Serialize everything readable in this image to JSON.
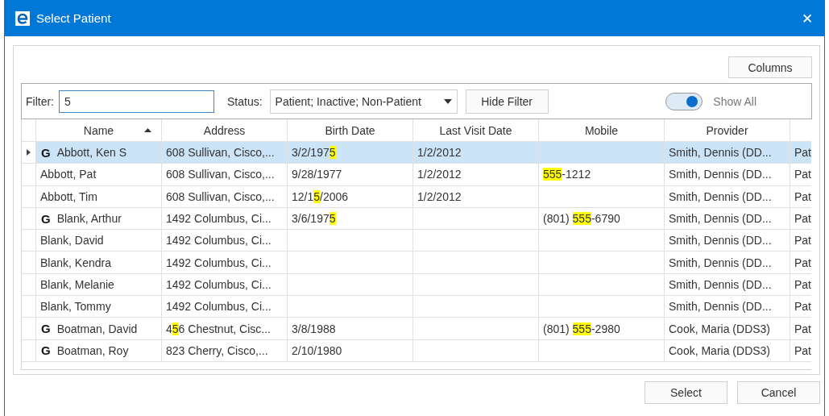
{
  "window": {
    "title": "Select Patient",
    "close": "✕"
  },
  "columns_button": "Columns",
  "filter": {
    "label": "Filter:",
    "value": "5",
    "status_label": "Status:",
    "status_value": "Patient; Inactive; Non-Patient",
    "hide_button": "Hide Filter",
    "show_all": {
      "label": "Show All",
      "on": true
    }
  },
  "table": {
    "columns": [
      {
        "label": "Name",
        "sorted": true
      },
      {
        "label": "Address",
        "sorted": false
      },
      {
        "label": "Birth Date",
        "sorted": false
      },
      {
        "label": "Last Visit Date",
        "sorted": false
      },
      {
        "label": "Mobile",
        "sorted": false
      },
      {
        "label": "Provider",
        "sorted": false
      }
    ],
    "rows": [
      {
        "selected": true,
        "mark": "G",
        "cells": [
          [
            {
              "text": "Abbott, Ken S"
            }
          ],
          [
            {
              "text": "608 Sullivan, Cisco,..."
            }
          ],
          [
            {
              "text": "3/2/197"
            },
            {
              "text": "5",
              "highlighted": true
            }
          ],
          [
            {
              "text": "1/2/2012"
            }
          ],
          [],
          [
            {
              "text": "Smith, Dennis (DD..."
            }
          ],
          [
            {
              "text": "Pat"
            }
          ]
        ]
      },
      {
        "selected": false,
        "cells": [
          [
            {
              "text": "Abbott, Pat"
            }
          ],
          [
            {
              "text": "608 Sullivan, Cisco,..."
            }
          ],
          [
            {
              "text": "9/28/1977"
            }
          ],
          [
            {
              "text": "1/2/2012"
            }
          ],
          [
            {
              "text": "555",
              "highlighted": true
            },
            {
              "text": "-1212"
            }
          ],
          [
            {
              "text": "Smith, Dennis (DD..."
            }
          ],
          [
            {
              "text": "Pat"
            }
          ]
        ]
      },
      {
        "selected": false,
        "cells": [
          [
            {
              "text": "Abbott, Tim"
            }
          ],
          [
            {
              "text": "608 Sullivan, Cisco,..."
            }
          ],
          [
            {
              "text": "12/1"
            },
            {
              "text": "5",
              "highlighted": true
            },
            {
              "text": "/2006"
            }
          ],
          [
            {
              "text": "1/2/2012"
            }
          ],
          [],
          [
            {
              "text": "Smith, Dennis (DD..."
            }
          ],
          [
            {
              "text": "Pat"
            }
          ]
        ]
      },
      {
        "selected": false,
        "mark": "G",
        "cells": [
          [
            {
              "text": "Blank, Arthur"
            }
          ],
          [
            {
              "text": "1492 Columbus, Ci..."
            }
          ],
          [
            {
              "text": "3/6/197"
            },
            {
              "text": "5",
              "highlighted": true
            }
          ],
          [],
          [
            {
              "text": "(801) "
            },
            {
              "text": "555",
              "highlighted": true
            },
            {
              "text": "-6790"
            }
          ],
          [
            {
              "text": "Smith, Dennis (DD..."
            }
          ],
          [
            {
              "text": "Pat"
            }
          ]
        ]
      },
      {
        "selected": false,
        "cells": [
          [
            {
              "text": "Blank, David"
            }
          ],
          [
            {
              "text": "1492 Columbus, Ci..."
            }
          ],
          [],
          [],
          [],
          [
            {
              "text": "Smith, Dennis (DD..."
            }
          ],
          [
            {
              "text": "Pat"
            }
          ]
        ]
      },
      {
        "selected": false,
        "cells": [
          [
            {
              "text": "Blank, Kendra"
            }
          ],
          [
            {
              "text": "1492 Columbus, Ci..."
            }
          ],
          [],
          [],
          [],
          [
            {
              "text": "Smith, Dennis (DD..."
            }
          ],
          [
            {
              "text": "Pat"
            }
          ]
        ]
      },
      {
        "selected": false,
        "cells": [
          [
            {
              "text": "Blank, Melanie"
            }
          ],
          [
            {
              "text": "1492 Columbus, Ci..."
            }
          ],
          [],
          [],
          [],
          [
            {
              "text": "Smith, Dennis (DD..."
            }
          ],
          [
            {
              "text": "Pat"
            }
          ]
        ]
      },
      {
        "selected": false,
        "cells": [
          [
            {
              "text": "Blank, Tommy"
            }
          ],
          [
            {
              "text": "1492 Columbus, Ci..."
            }
          ],
          [],
          [],
          [],
          [
            {
              "text": "Smith, Dennis (DD..."
            }
          ],
          [
            {
              "text": "Pat"
            }
          ]
        ]
      },
      {
        "selected": false,
        "mark": "G",
        "cells": [
          [
            {
              "text": "Boatman, David"
            }
          ],
          [
            {
              "text": "4"
            },
            {
              "text": "5",
              "highlighted": true
            },
            {
              "text": "6 Chestnut, Cisc..."
            }
          ],
          [
            {
              "text": "3/8/1988"
            }
          ],
          [],
          [
            {
              "text": "(801) "
            },
            {
              "text": "555",
              "highlighted": true
            },
            {
              "text": "-2980"
            }
          ],
          [
            {
              "text": "Cook, Maria (DDS3)"
            }
          ],
          [
            {
              "text": "Pat"
            }
          ]
        ]
      },
      {
        "selected": false,
        "mark": "G",
        "cells": [
          [
            {
              "text": "Boatman, Roy"
            }
          ],
          [
            {
              "text": "823 Cherry, Cisco,..."
            }
          ],
          [
            {
              "text": "2/10/1980"
            }
          ],
          [],
          [],
          [
            {
              "text": "Cook, Maria (DDS3)"
            }
          ],
          [
            {
              "text": "Pat"
            }
          ]
        ]
      }
    ]
  },
  "buttons": [
    "Select",
    "Cancel"
  ]
}
